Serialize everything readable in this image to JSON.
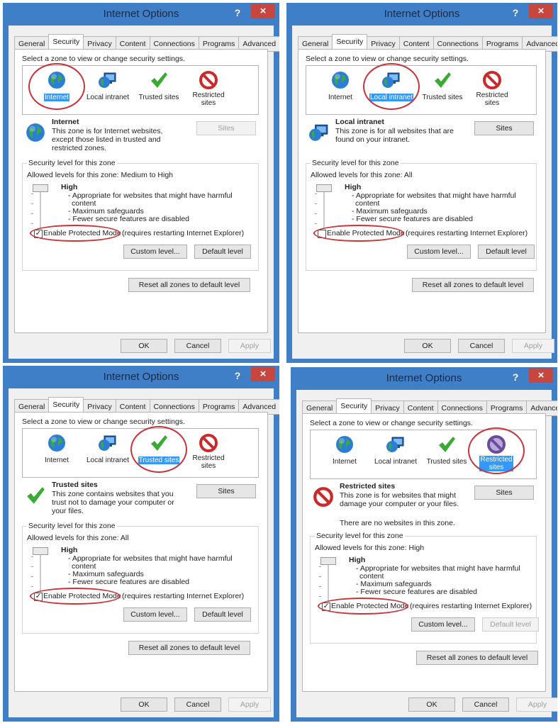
{
  "dialog": {
    "title": "Internet Options",
    "help": "?",
    "close": "×",
    "tabs": [
      "General",
      "Security",
      "Privacy",
      "Content",
      "Connections",
      "Programs",
      "Advanced"
    ],
    "prompt": "Select a zone to view or change security settings.",
    "zones": [
      "Internet",
      "Local intranet",
      "Trusted sites",
      "Restricted",
      "sites"
    ],
    "buttons": {
      "sites": "Sites",
      "custom": "Custom level...",
      "default": "Default level",
      "reset": "Reset all zones to default level",
      "ok": "OK",
      "cancel": "Cancel",
      "apply": "Apply"
    },
    "group_label": "Security level for this zone",
    "level_title": "High",
    "level_lines": [
      "- Appropriate for websites that might have harmful",
      "content",
      "- Maximum safeguards",
      "- Fewer secure features are disabled"
    ],
    "protected_mode": "Enable Protected Mode",
    "protected_suffix": "(requires restarting Internet Explorer)"
  },
  "panels": [
    {
      "selected_zone": "Internet",
      "zone_name": "Internet",
      "desc": [
        "This zone is for Internet websites,",
        "except those listed in trusted and",
        "restricted zones."
      ],
      "extra": "",
      "allowed": "Allowed levels for this zone: Medium to High",
      "sites_disabled": true,
      "default_disabled": false,
      "protected_checked": true
    },
    {
      "selected_zone": "Local intranet",
      "zone_name": "Local intranet",
      "desc": [
        "This zone is for all websites that are",
        "found on your intranet."
      ],
      "extra": "",
      "allowed": "Allowed levels for this zone: All",
      "sites_disabled": false,
      "default_disabled": false,
      "protected_checked": false
    },
    {
      "selected_zone": "Trusted sites",
      "zone_name": "Trusted sites",
      "desc": [
        "This zone contains websites that you",
        "trust not to damage your computer or",
        "your files."
      ],
      "extra": "",
      "allowed": "Allowed levels for this zone: All",
      "sites_disabled": false,
      "default_disabled": false,
      "protected_checked": true
    },
    {
      "selected_zone": "Restricted sites",
      "zone_name": "Restricted sites",
      "desc": [
        "This zone is for websites that might",
        "damage your computer or your files."
      ],
      "extra": "There are no websites in this zone.",
      "allowed": "Allowed levels for this zone: High",
      "sites_disabled": false,
      "default_disabled": true,
      "protected_checked": true
    }
  ],
  "colors": {
    "title_bar": "#3f7fc8",
    "close_button": "#c7463d",
    "highlight_oval": "#c8343a",
    "selection": "#3399ff"
  }
}
